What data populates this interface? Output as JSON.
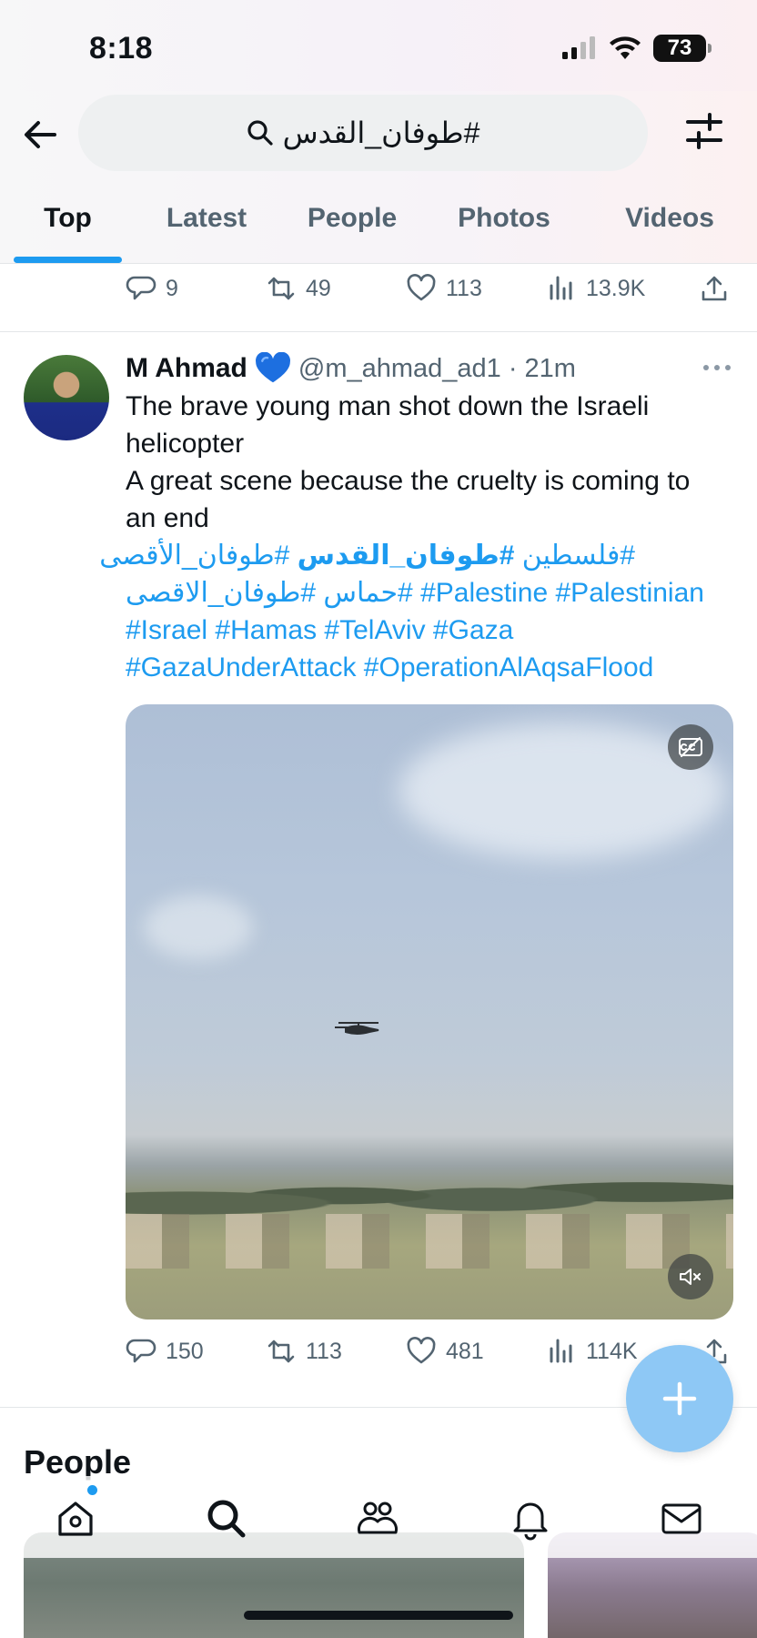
{
  "status_bar": {
    "time": "8:18",
    "battery": "73"
  },
  "header": {
    "search_query": "#طوفان_القدس",
    "tabs": [
      {
        "label": "Top",
        "active": true
      },
      {
        "label": "Latest",
        "active": false
      },
      {
        "label": "People",
        "active": false
      },
      {
        "label": "Photos",
        "active": false
      },
      {
        "label": "Videos",
        "active": false
      }
    ]
  },
  "previous_tweet": {
    "actions": {
      "replies": "9",
      "reposts": "49",
      "likes": "113",
      "views": "13.9K"
    }
  },
  "tweet": {
    "author_name": "M Ahmad",
    "handle": "@m_ahmad_ad1",
    "separator": "·",
    "time": "21m",
    "text_lines": [
      "The brave young man shot down the Israeli",
      "helicopter",
      "A great scene because the cruelty is coming to",
      "an end"
    ],
    "hashtag_lines": [
      {
        "segments": [
          {
            "text": "#فلسطين ",
            "bold": false
          },
          {
            "text": "#طوفان_القدس",
            "bold": true
          },
          {
            "text": " #طوفان_الأقصى",
            "bold": false
          }
        ]
      },
      {
        "segments": [
          {
            "text": "#حماس #طوفان_الاقصى",
            "bold": false
          },
          {
            "text": " #Palestine #Palestinian",
            "bold": false
          }
        ]
      },
      {
        "segments": [
          {
            "text": "#Israel #Hamas #TelAviv #Gaza",
            "bold": false
          }
        ]
      },
      {
        "segments": [
          {
            "text": "#GazaUnderAttack #OperationAlAqsaFlood",
            "bold": false
          }
        ]
      }
    ],
    "actions": {
      "replies": "150",
      "reposts": "113",
      "likes": "481",
      "views": "114K"
    }
  },
  "people_section": {
    "heading": "People"
  },
  "colors": {
    "accent": "#1d9bf0",
    "fab": "#8ec8f5",
    "text": "#0f1419",
    "secondary": "#536471"
  }
}
